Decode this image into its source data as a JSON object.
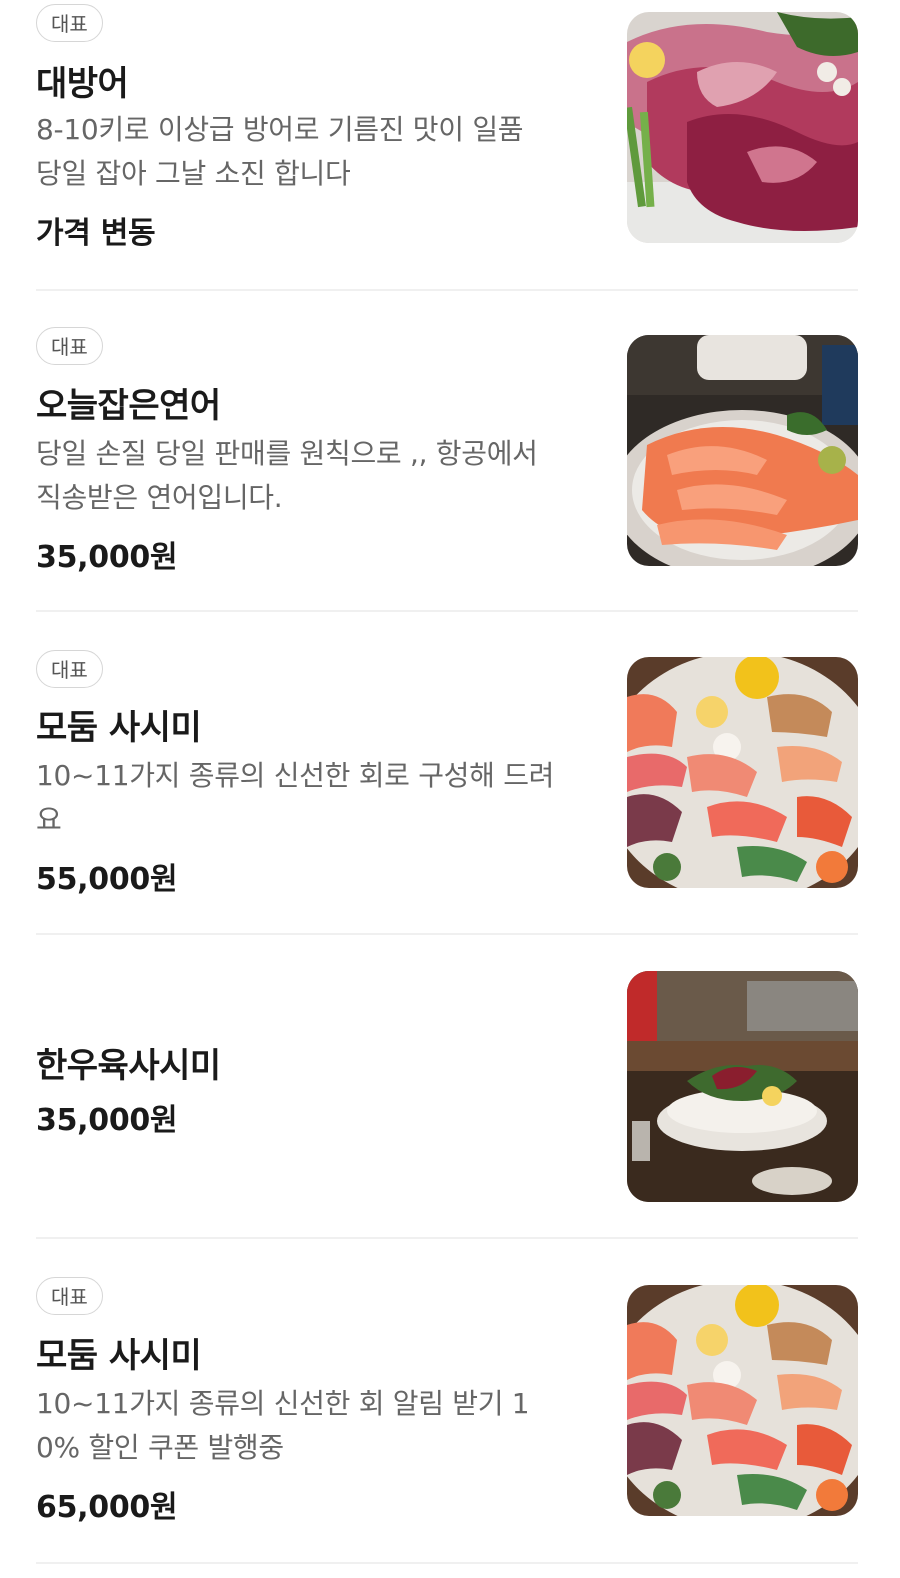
{
  "menu": {
    "items": [
      {
        "badge": "대표",
        "name": "대방어",
        "desc_line1": "8-10키로 이상급 방어로 기름진 맛이 일품",
        "desc_line2": "당일 잡아 그날 소진 합니다",
        "price": "가격 변동",
        "photo_icon": "yellowtail-sashimi-photo"
      },
      {
        "badge": "대표",
        "name": "오늘잡은연어",
        "desc_line1": "당일 손질 당일 판매를 원칙으로 ,, 항공에서",
        "desc_line2": "직송받은 연어입니다.",
        "price": "35,000원",
        "photo_icon": "salmon-sashimi-photo"
      },
      {
        "badge": "대표",
        "name": "모둠 사시미",
        "desc_line1": "10~11가지 종류의 신선한 회로 구성해 드려",
        "desc_line2": "요",
        "price": "55,000원",
        "photo_icon": "assorted-sashimi-photo"
      },
      {
        "name": "한우육사시미",
        "price": "35,000원",
        "photo_icon": "beef-sashimi-photo"
      },
      {
        "badge": "대표",
        "name": "모둠 사시미",
        "desc_line1": "10~11가지 종류의 신선한 회 알림 받기 1",
        "desc_line2": "0% 할인 쿠폰 발행중",
        "price": "65,000원",
        "photo_icon": "assorted-sashimi-photo"
      }
    ]
  }
}
